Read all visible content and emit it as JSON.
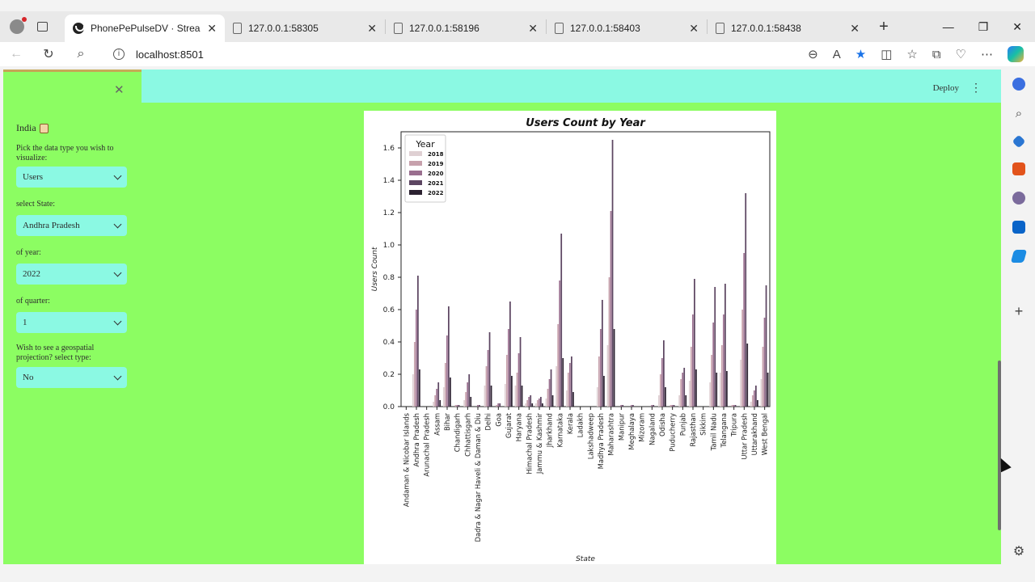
{
  "browser": {
    "tabs": [
      {
        "label": "PhonePePulseDV · Streamlit",
        "active": true
      },
      {
        "label": "127.0.0.1:58305",
        "active": false
      },
      {
        "label": "127.0.0.1:58196",
        "active": false
      },
      {
        "label": "127.0.0.1:58403",
        "active": false
      },
      {
        "label": "127.0.0.1:58438",
        "active": false
      }
    ],
    "url": "localhost:8501"
  },
  "app": {
    "deploy_label": "Deploy"
  },
  "sidebar": {
    "title": "India",
    "data_type_label": "Pick the data type you wish to visualize:",
    "data_type_value": "Users",
    "state_label": "select State:",
    "state_value": "Andhra Pradesh",
    "year_label": "of year:",
    "year_value": "2022",
    "quarter_label": "of quarter:",
    "quarter_value": "1",
    "geo_label": "Wish to see a geospatial projection? select type:",
    "geo_value": "No"
  },
  "colors": {
    "sidebar_bg": "#8cfd62",
    "header_bg": "#8bf9e3",
    "series": [
      "#dfd0d3",
      "#c7a1ac",
      "#9a6f8f",
      "#5c4561",
      "#2b2130"
    ]
  },
  "chart_data": {
    "type": "bar",
    "title": "Users Count by Year",
    "xlabel": "State",
    "ylabel": "Users Count",
    "ylim": [
      0,
      1.7
    ],
    "yticks": [
      0.0,
      0.2,
      0.4,
      0.6,
      0.8,
      1.0,
      1.2,
      1.4,
      1.6
    ],
    "legend_title": "Year",
    "legend_position": "top-left",
    "categories": [
      "Andaman & Nicobar Islands",
      "Andhra Pradesh",
      "Arunachal Pradesh",
      "Assam",
      "Bihar",
      "Chandigarh",
      "Chhattisgarh",
      "Dadra & Nagar Haveli & Daman & Diu",
      "Delhi",
      "Goa",
      "Gujarat",
      "Haryana",
      "Himachal Pradesh",
      "Jammu & Kashmir",
      "Jharkhand",
      "Karnataka",
      "Kerala",
      "Ladakh",
      "Lakshadweep",
      "Madhya Pradesh",
      "Maharashtra",
      "Manipur",
      "Meghalaya",
      "Mizoram",
      "Nagaland",
      "Odisha",
      "Puducherry",
      "Punjab",
      "Rajasthan",
      "Sikkim",
      "Tamil Nadu",
      "Telangana",
      "Tripura",
      "Uttar Pradesh",
      "Uttarakhand",
      "West Bengal"
    ],
    "series": [
      {
        "name": "2018",
        "values": [
          0.0,
          0.2,
          0.0,
          0.03,
          0.12,
          0.0,
          0.04,
          0.0,
          0.13,
          0.0,
          0.14,
          0.13,
          0.02,
          0.02,
          0.05,
          0.25,
          0.1,
          0.0,
          0.0,
          0.12,
          0.38,
          0.0,
          0.0,
          0.0,
          0.0,
          0.07,
          0.0,
          0.07,
          0.16,
          0.0,
          0.15,
          0.21,
          0.0,
          0.29,
          0.03,
          0.17
        ]
      },
      {
        "name": "2019",
        "values": [
          0.0,
          0.4,
          0.0,
          0.07,
          0.27,
          0.01,
          0.09,
          0.0,
          0.25,
          0.01,
          0.32,
          0.21,
          0.04,
          0.04,
          0.11,
          0.51,
          0.21,
          0.0,
          0.0,
          0.31,
          0.8,
          0.0,
          0.0,
          0.0,
          0.0,
          0.2,
          0.01,
          0.17,
          0.37,
          0.0,
          0.32,
          0.38,
          0.01,
          0.6,
          0.07,
          0.37
        ]
      },
      {
        "name": "2020",
        "values": [
          0.0,
          0.6,
          0.0,
          0.11,
          0.44,
          0.01,
          0.15,
          0.01,
          0.35,
          0.02,
          0.48,
          0.33,
          0.06,
          0.05,
          0.17,
          0.78,
          0.27,
          0.0,
          0.0,
          0.48,
          1.21,
          0.01,
          0.01,
          0.0,
          0.01,
          0.3,
          0.01,
          0.21,
          0.57,
          0.0,
          0.52,
          0.57,
          0.01,
          0.95,
          0.1,
          0.55
        ]
      },
      {
        "name": "2021",
        "values": [
          0.0,
          0.81,
          0.0,
          0.15,
          0.62,
          0.01,
          0.2,
          0.01,
          0.46,
          0.02,
          0.65,
          0.43,
          0.07,
          0.06,
          0.23,
          1.07,
          0.31,
          0.0,
          0.0,
          0.66,
          1.65,
          0.01,
          0.01,
          0.0,
          0.01,
          0.41,
          0.01,
          0.24,
          0.79,
          0.0,
          0.74,
          0.76,
          0.01,
          1.32,
          0.13,
          0.75
        ]
      },
      {
        "name": "2022",
        "values": [
          0.0,
          0.23,
          0.0,
          0.04,
          0.18,
          0.0,
          0.06,
          0.0,
          0.13,
          0.0,
          0.19,
          0.13,
          0.02,
          0.02,
          0.07,
          0.3,
          0.09,
          0.0,
          0.0,
          0.19,
          0.48,
          0.0,
          0.0,
          0.0,
          0.0,
          0.12,
          0.0,
          0.07,
          0.23,
          0.0,
          0.21,
          0.22,
          0.0,
          0.39,
          0.04,
          0.21
        ]
      }
    ]
  }
}
